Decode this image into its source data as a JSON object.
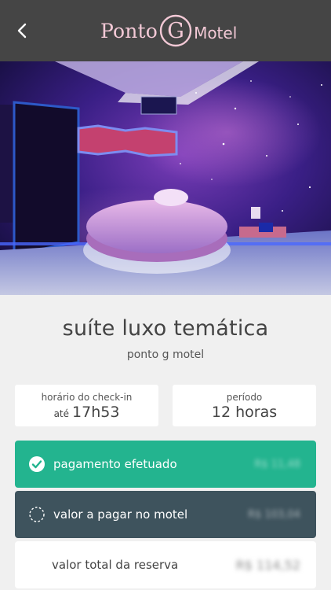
{
  "header": {
    "logo_word": "Ponto",
    "logo_letter": "G",
    "logo_suffix": "Motel",
    "brand_color": "#f3c9d6",
    "back_icon": "chevron-left-icon"
  },
  "room": {
    "title": "suíte luxo temática",
    "motel": "ponto g motel"
  },
  "checkin": {
    "label": "horário do check-in",
    "prefix": "até",
    "time": "17h53"
  },
  "period": {
    "label": "período",
    "value": "12 horas"
  },
  "payments": {
    "paid_label": "pagamento efetuado",
    "paid_amount": "R$ 11,48",
    "paid_icon": "check-circle-icon",
    "due_label": "valor a pagar no motel",
    "due_amount": "R$ 103,04",
    "due_icon": "dashed-circle-icon",
    "total_label": "valor total da reserva",
    "total_amount": "R$ 114,52"
  },
  "colors": {
    "topbar": "#454545",
    "paid": "#23b48f",
    "due": "#3e535d"
  }
}
